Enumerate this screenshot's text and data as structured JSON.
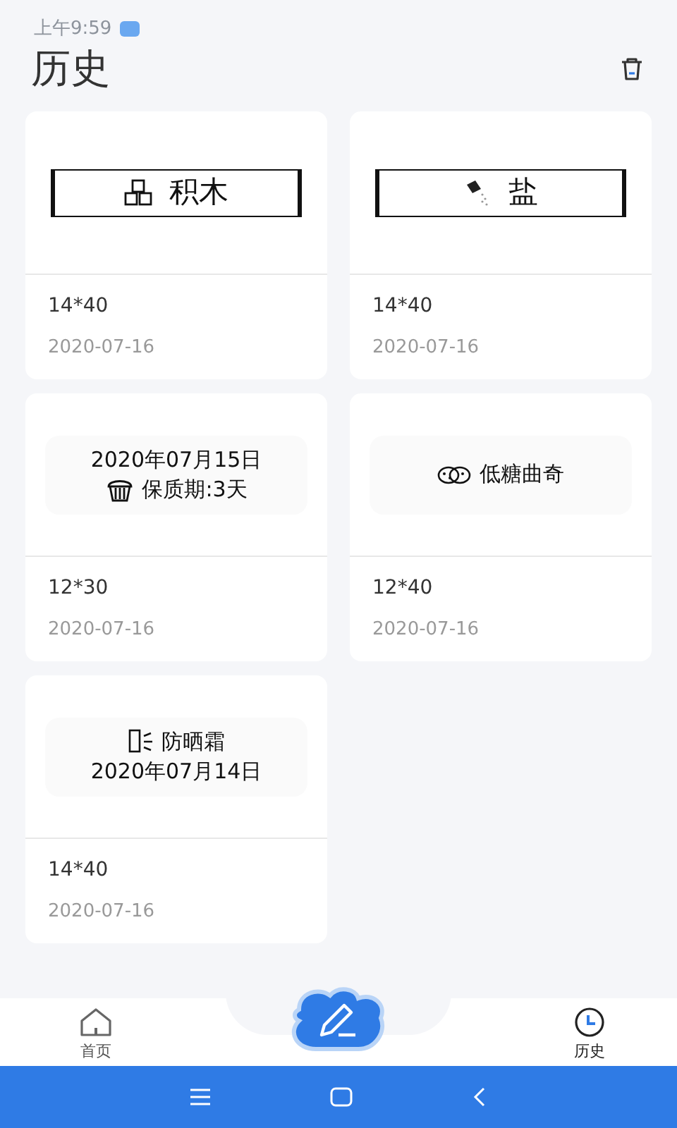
{
  "status_bar": {
    "time": "上午9:59"
  },
  "header": {
    "title": "历史"
  },
  "labels": [
    {
      "preview": {
        "kind": "framed",
        "lines": [
          {
            "text": "积木",
            "icon": true
          }
        ]
      },
      "size": "14*40",
      "date": "2020-07-16"
    },
    {
      "preview": {
        "kind": "framed",
        "lines": [
          {
            "text": "盐",
            "icon": true
          }
        ]
      },
      "size": "14*40",
      "date": "2020-07-16"
    },
    {
      "preview": {
        "kind": "panel",
        "lines": [
          {
            "text": "2020年07月15日",
            "icon": false
          },
          {
            "text": "保质期:3天",
            "icon": true
          }
        ]
      },
      "size": "12*30",
      "date": "2020-07-16"
    },
    {
      "preview": {
        "kind": "panel",
        "lines": [
          {
            "text": "低糖曲奇",
            "icon": true
          }
        ]
      },
      "size": "12*40",
      "date": "2020-07-16"
    },
    {
      "preview": {
        "kind": "panel",
        "lines": [
          {
            "text": "防晒霜",
            "icon": true
          },
          {
            "text": "2020年07月14日",
            "icon": false
          }
        ]
      },
      "size": "14*40",
      "date": "2020-07-16"
    }
  ],
  "bottom_nav": [
    {
      "label": "首页",
      "selected": false
    },
    {
      "label": "历史",
      "selected": true
    }
  ]
}
